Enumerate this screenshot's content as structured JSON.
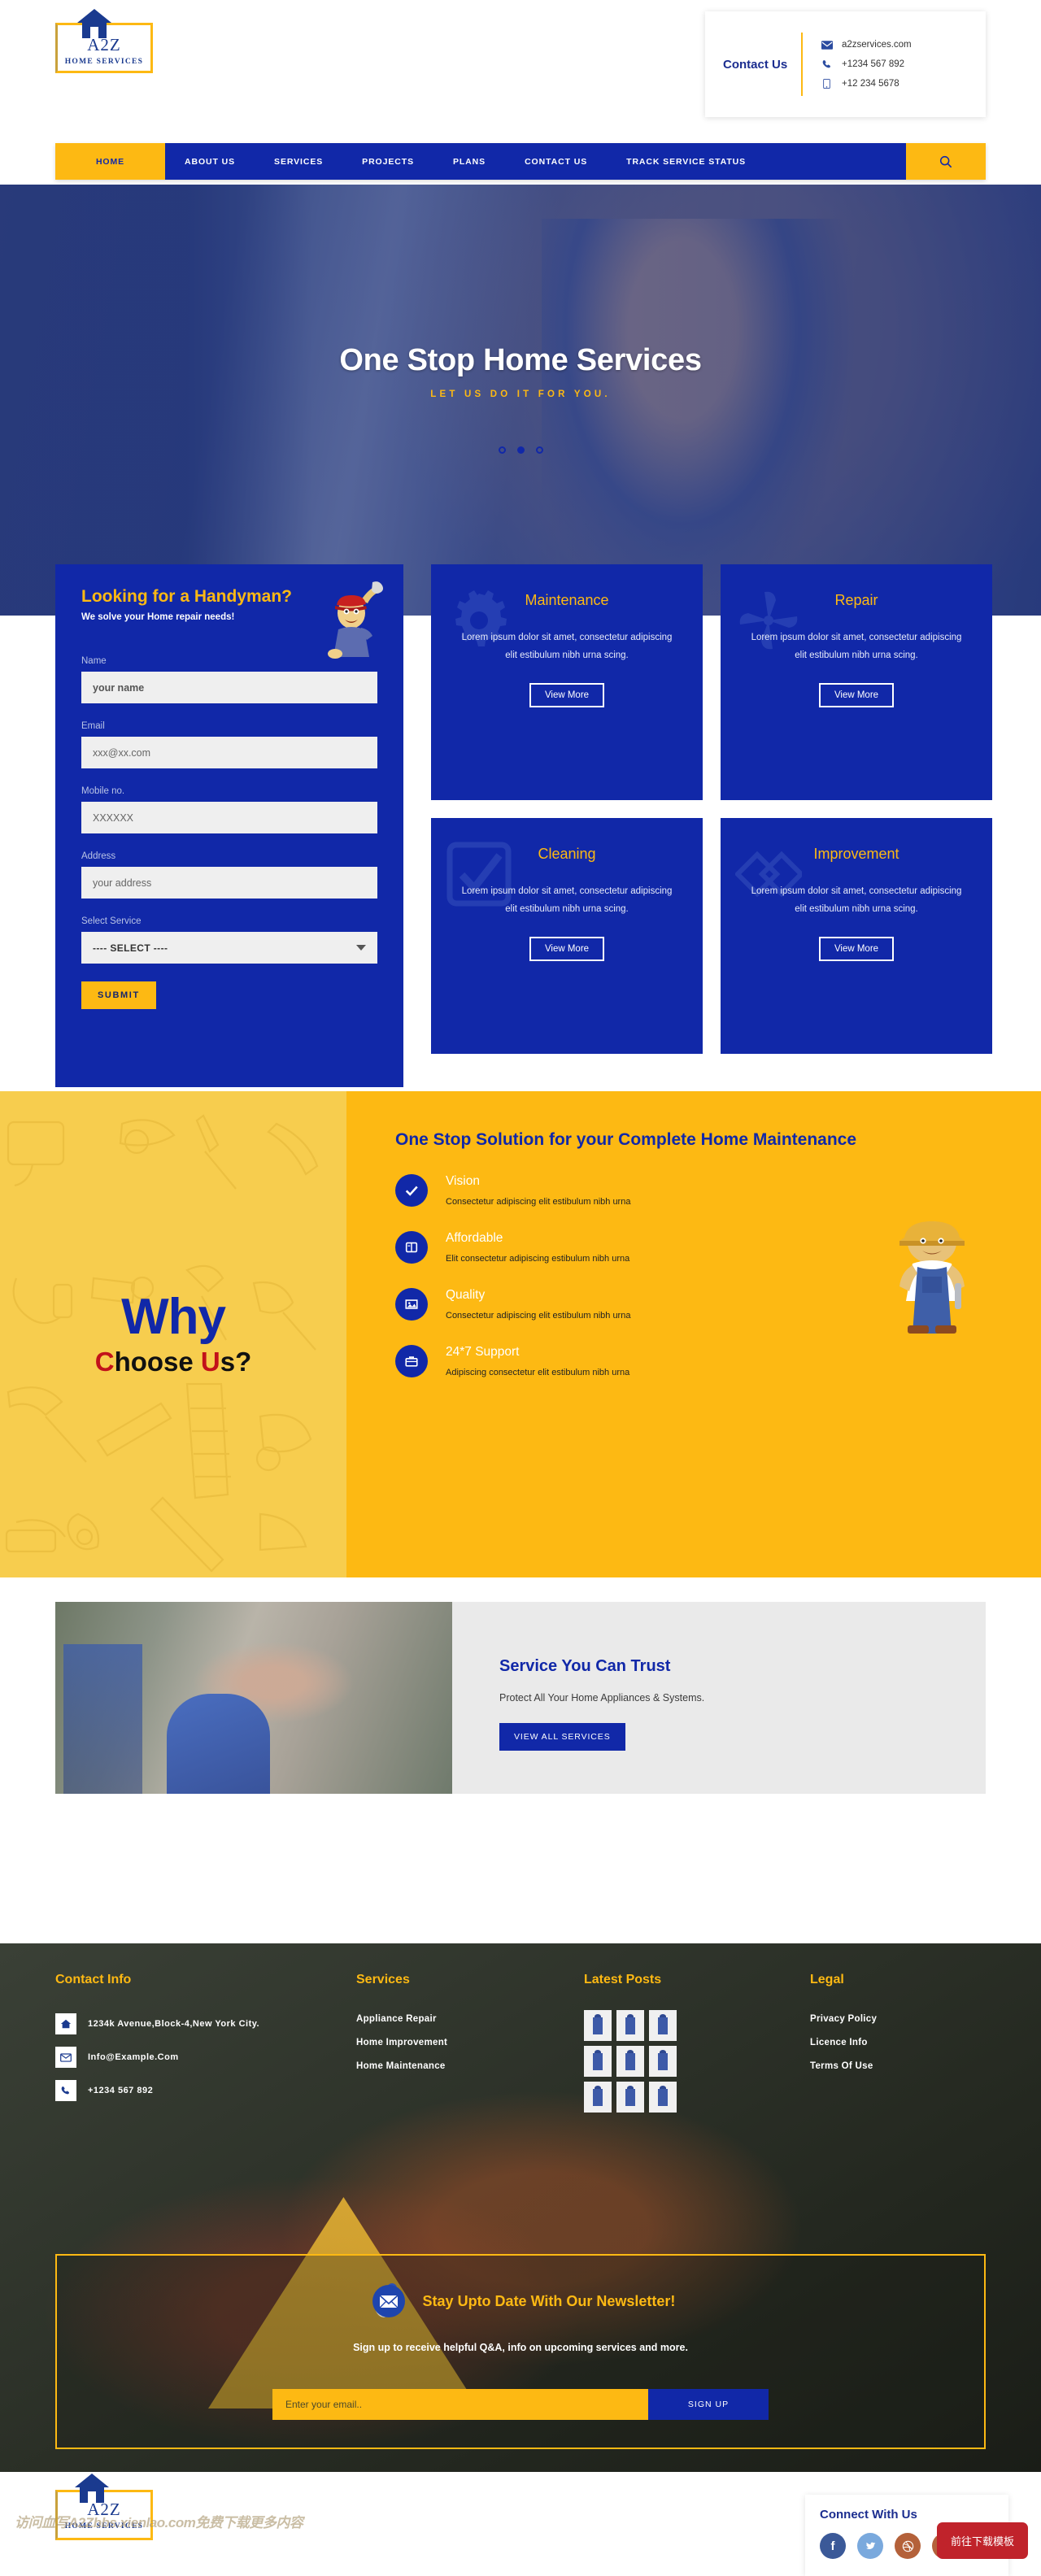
{
  "brand": {
    "name": "A2Z",
    "tagline": "HOME SERVICES",
    "house_icon": "house-icon"
  },
  "header": {
    "contact_title": "Contact Us",
    "contact_items": [
      {
        "icon": "envelope-icon",
        "value": "a2zservices.com"
      },
      {
        "icon": "phone-icon",
        "value": "+1234 567 892"
      },
      {
        "icon": "mobile-icon",
        "value": "+12 234 5678"
      }
    ]
  },
  "nav": {
    "items": [
      {
        "label": "HOME",
        "active": true
      },
      {
        "label": "ABOUT US",
        "active": false
      },
      {
        "label": "SERVICES",
        "active": false
      },
      {
        "label": "PROJECTS",
        "active": false
      },
      {
        "label": "PLANS",
        "active": false
      },
      {
        "label": "CONTACT US",
        "active": false
      },
      {
        "label": "TRACK SERVICE STATUS",
        "active": false
      }
    ],
    "search_icon": "search-icon"
  },
  "hero": {
    "title": "One Stop Home Services",
    "subtitle": "LET US DO IT FOR YOU.",
    "dots": 3,
    "active_dot": 2
  },
  "form": {
    "title": "Looking for a Handyman?",
    "subtitle": "We solve your Home repair needs!",
    "fields": [
      {
        "label": "Name",
        "placeholder": "your name"
      },
      {
        "label": "Email",
        "placeholder": "xxx@xx.com"
      },
      {
        "label": "Mobile no.",
        "placeholder": "XXXXXX"
      },
      {
        "label": "Address",
        "placeholder": "your address"
      }
    ],
    "select_label": "Select Service",
    "select_value": "---- SELECT ----",
    "submit_label": "SUBMIT"
  },
  "services": {
    "cards": [
      {
        "title": "Maintenance",
        "icon": "gear-icon",
        "desc": "Lorem ipsum dolor sit amet, consectetur adipiscing elit estibulum nibh urna scing.",
        "button": "View More"
      },
      {
        "title": "Repair",
        "icon": "fan-icon",
        "desc": "Lorem ipsum dolor sit amet, consectetur adipiscing elit estibulum nibh urna scing.",
        "button": "View More"
      },
      {
        "title": "Cleaning",
        "icon": "check-square-icon",
        "desc": "Lorem ipsum dolor sit amet, consectetur adipiscing elit estibulum nibh urna scing.",
        "button": "View More"
      },
      {
        "title": "Improvement",
        "icon": "diamond-icon",
        "desc": "Lorem ipsum dolor sit amet, consectetur adipiscing elit estibulum nibh urna scing.",
        "button": "View More"
      }
    ]
  },
  "why": {
    "word1": "Why",
    "word2_c": "C",
    "word2_hoose": "hoose",
    "word2_u": "U",
    "word2_s": "s?",
    "title": "One Stop Solution for your Complete Home Maintenance",
    "features": [
      {
        "icon": "check-circle-icon",
        "heading": "Vision",
        "text": "Consectetur adipiscing elit estibulum nibh urna"
      },
      {
        "icon": "book-icon",
        "heading": "Affordable",
        "text": "Elit consectetur adipiscing estibulum nibh urna"
      },
      {
        "icon": "image-icon",
        "heading": "Quality",
        "text": "Consectetur adipiscing elit estibulum nibh urna"
      },
      {
        "icon": "briefcase-icon",
        "heading": "24*7 Support",
        "text": "Adipiscing consectetur elit estibulum nibh urna"
      }
    ]
  },
  "trust": {
    "heading": "Service You Can Trust",
    "text": "Protect All Your Home Appliances & Systems.",
    "button": "VIEW ALL SERVICES"
  },
  "footer": {
    "contact_head": "Contact Info",
    "contact_items": [
      {
        "icon": "home-icon",
        "value": "1234k Avenue,Block-4,New York City."
      },
      {
        "icon": "envelope-icon",
        "value": "Info@Example.Com"
      },
      {
        "icon": "phone-icon",
        "value": "+1234 567 892"
      }
    ],
    "services_head": "Services",
    "services": [
      "Appliance Repair",
      "Home Improvement",
      "Home Maintenance"
    ],
    "posts_head": "Latest Posts",
    "post_count": 9,
    "legal_head": "Legal",
    "legal": [
      "Privacy Policy",
      "Licence Info",
      "Terms Of Use"
    ]
  },
  "newsletter": {
    "icon": "envelope-icon",
    "title": "Stay Upto Date With Our Newsletter!",
    "subtitle": "Sign up to receive helpful Q&A, info on upcoming services and more.",
    "placeholder": "Enter your email..",
    "button": "SIGN UP"
  },
  "bottom": {
    "watermark": "访问血写A2Zbbs.xienlao.com免费下载更多内容",
    "connect_head": "Connect With Us",
    "socials": [
      {
        "name": "facebook-icon",
        "glyph": "f",
        "color": "#3b5998"
      },
      {
        "name": "twitter-icon",
        "glyph": "ᵛ",
        "color": "#7aa9dd"
      },
      {
        "name": "dribbble-icon",
        "glyph": "⊛",
        "color": "#b4613a"
      },
      {
        "name": "google-plus-icon",
        "glyph": "G+",
        "color": "#b4613a"
      }
    ],
    "download_badge": "前往下载模板"
  },
  "colors": {
    "brand_blue": "#1128a8",
    "brand_yellow": "#FDB913",
    "accent_red": "#C2121A"
  }
}
